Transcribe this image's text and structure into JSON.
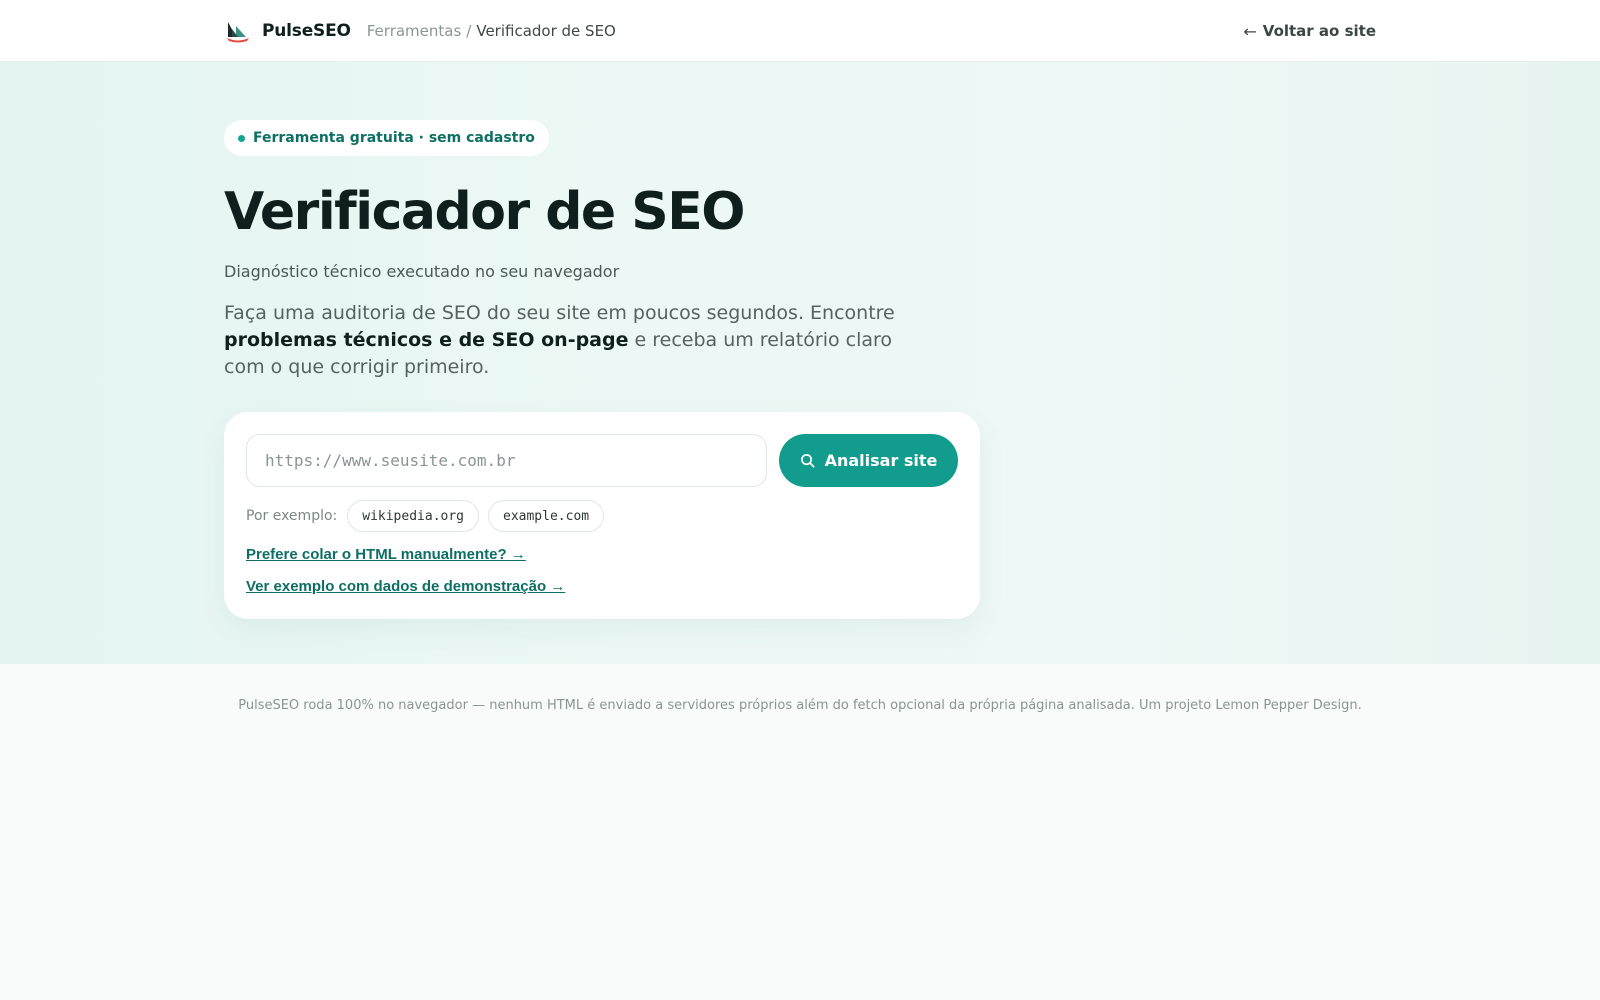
{
  "header": {
    "brand_name": "PulseSEO",
    "breadcrumb": {
      "parent": "Ferramentas",
      "separator": "/",
      "current": "Verificador de SEO"
    },
    "back_link": {
      "arrow": "←",
      "label": "Voltar ao site"
    }
  },
  "hero": {
    "badge": "Ferramenta gratuita · sem cadastro",
    "title": "Verificador de SEO",
    "subtitle": "Diagnóstico técnico executado no seu navegador",
    "lead": {
      "before": "Faça uma auditoria de SEO do seu site em poucos segundos. Encontre ",
      "emphasis": "problemas técnicos e de SEO on-page",
      "after": " e receba um relatório claro com o que corrigir primeiro."
    }
  },
  "form": {
    "url_input": {
      "value": "",
      "placeholder": "https://www.seusite.com.br"
    },
    "analyze_button": "Analisar site",
    "examples_label": "Por exemplo:",
    "examples": [
      "wikipedia.org",
      "example.com"
    ],
    "paste_html_link": "Prefere colar o HTML manualmente? →",
    "demo_link": "Ver exemplo com dados de demonstração →"
  },
  "footer": {
    "note": "PulseSEO roda 100% no navegador — nenhum HTML é enviado a servidores próprios além do fetch opcional da própria página analisada. Um projeto Lemon Pepper Design."
  },
  "colors": {
    "accent": "#129c8d",
    "accent_dark": "#0d6f63",
    "hero_bg": "#e9f6f3",
    "page_bg": "#f8fbfa"
  },
  "icons": {
    "logo": "sailboat-logo-icon",
    "search": "search-icon"
  }
}
